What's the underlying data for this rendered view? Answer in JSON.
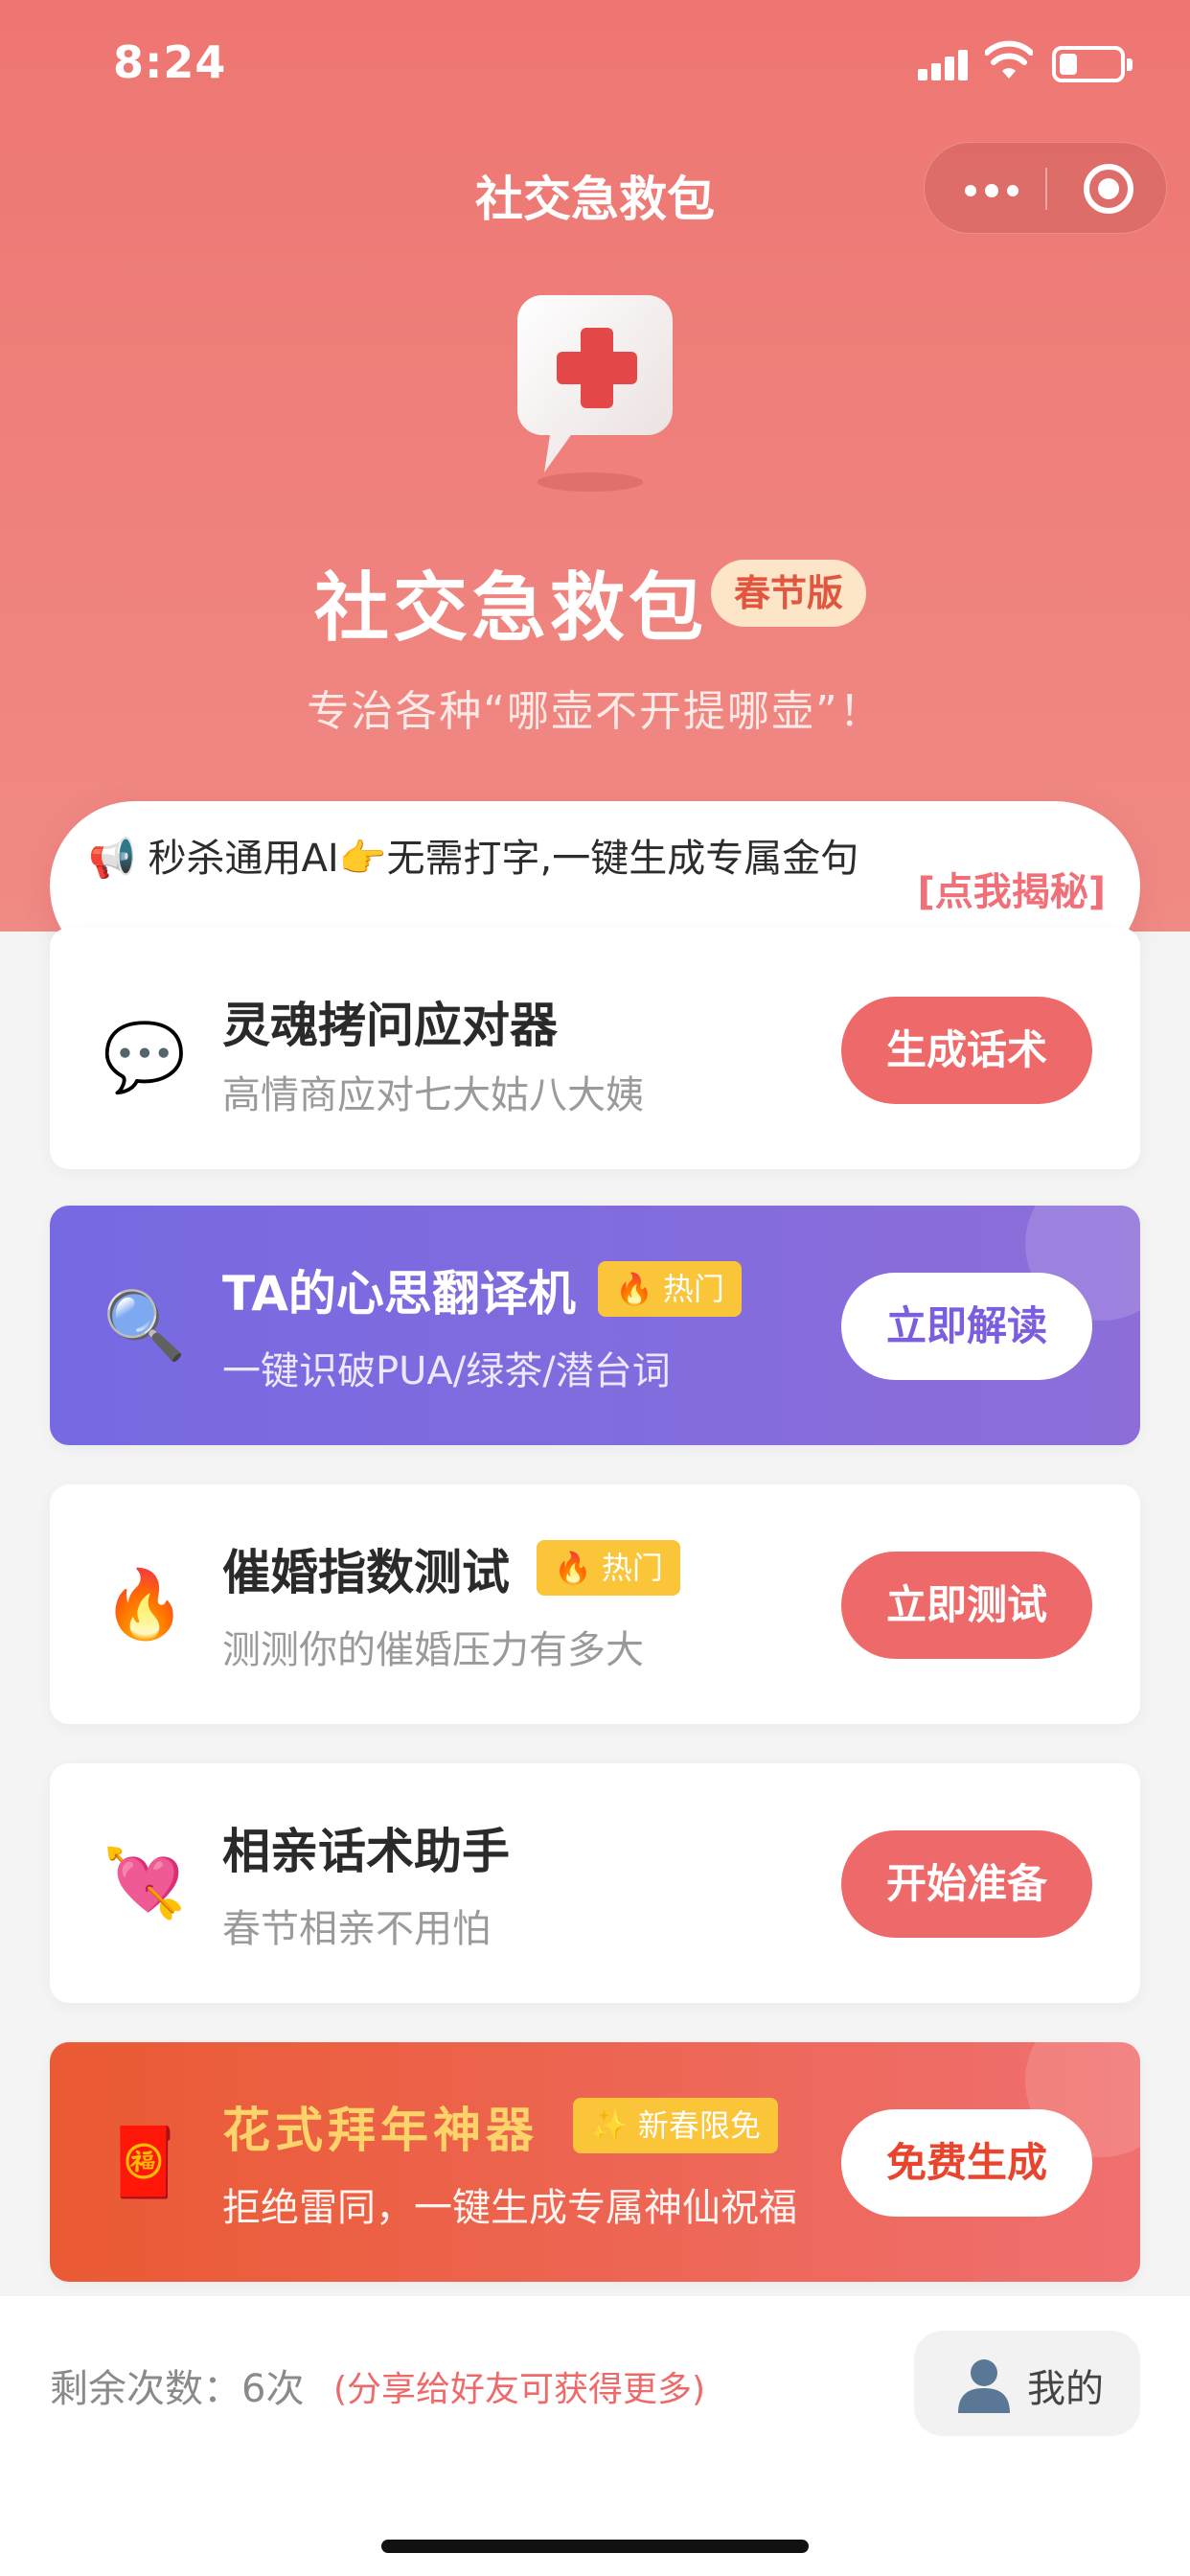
{
  "status": {
    "time": "8:24"
  },
  "nav": {
    "title": "社交急救包"
  },
  "hero": {
    "title": "社交急救包",
    "edition": "春节版",
    "subtitle": "专治各种“哪壶不开提哪壶”！"
  },
  "banner": {
    "text": "📢 秒杀通用AI👉无需打字,一键生成专属金句",
    "link": "[点我揭秘]"
  },
  "cards": [
    {
      "emoji": "💬",
      "title": "灵魂拷问应对器",
      "desc": "高情商应对七大姑八大姨",
      "button": "生成话术"
    },
    {
      "emoji": "🔍",
      "title": "TA的心思翻译机",
      "tag_icon": "🔥",
      "tag": "热门",
      "desc": "一键识破PUA/绿茶/潜台词",
      "button": "立即解读"
    },
    {
      "emoji": "🔥",
      "title": "催婚指数测试",
      "tag_icon": "🔥",
      "tag": "热门",
      "desc": "测测你的催婚压力有多大",
      "button": "立即测试"
    },
    {
      "emoji": "💘",
      "title": "相亲话术助手",
      "desc": "春节相亲不用怕",
      "button": "开始准备"
    },
    {
      "emoji": "🧧",
      "title": "花式拜年神器",
      "tag_icon": "✨",
      "tag": "新春限免",
      "desc": "拒绝雷同，一键生成专属神仙祝福",
      "button": "免费生成"
    }
  ],
  "footer": {
    "remain": "剩余次数：6次",
    "share": "(分享给好友可获得更多)",
    "mine": "我的"
  },
  "colors": {
    "primary": "#ee6a6a",
    "purple": "#7b5ee0",
    "gold": "#fbc53a"
  }
}
